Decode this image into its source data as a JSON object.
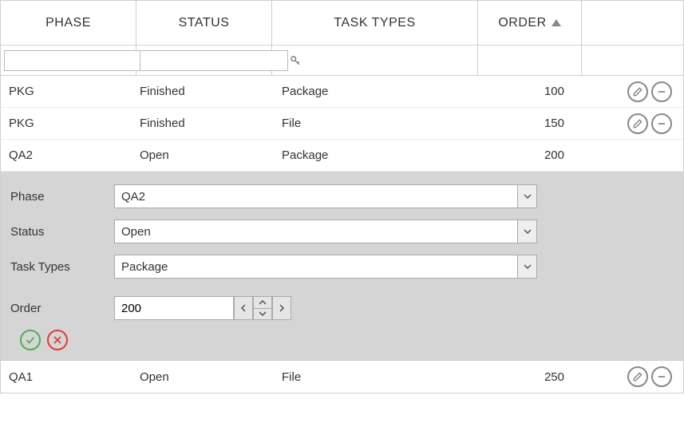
{
  "columns": {
    "phase": "PHASE",
    "status": "STATUS",
    "task_types": "TASK TYPES",
    "order": "ORDER"
  },
  "sort": {
    "column": "order",
    "direction": "asc"
  },
  "filters": {
    "phase": "",
    "status": ""
  },
  "rows": [
    {
      "phase": "PKG",
      "status": "Finished",
      "task_types": "Package",
      "order": 100,
      "actions": true
    },
    {
      "phase": "PKG",
      "status": "Finished",
      "task_types": "File",
      "order": 150,
      "actions": true
    },
    {
      "phase": "QA2",
      "status": "Open",
      "task_types": "Package",
      "order": 200,
      "editing": true
    },
    {
      "phase": "QA1",
      "status": "Open",
      "task_types": "File",
      "order": 250,
      "actions": true
    }
  ],
  "edit_form": {
    "labels": {
      "phase": "Phase",
      "status": "Status",
      "task_types": "Task Types",
      "order": "Order"
    },
    "values": {
      "phase": "QA2",
      "status": "Open",
      "task_types": "Package",
      "order": "200"
    }
  }
}
